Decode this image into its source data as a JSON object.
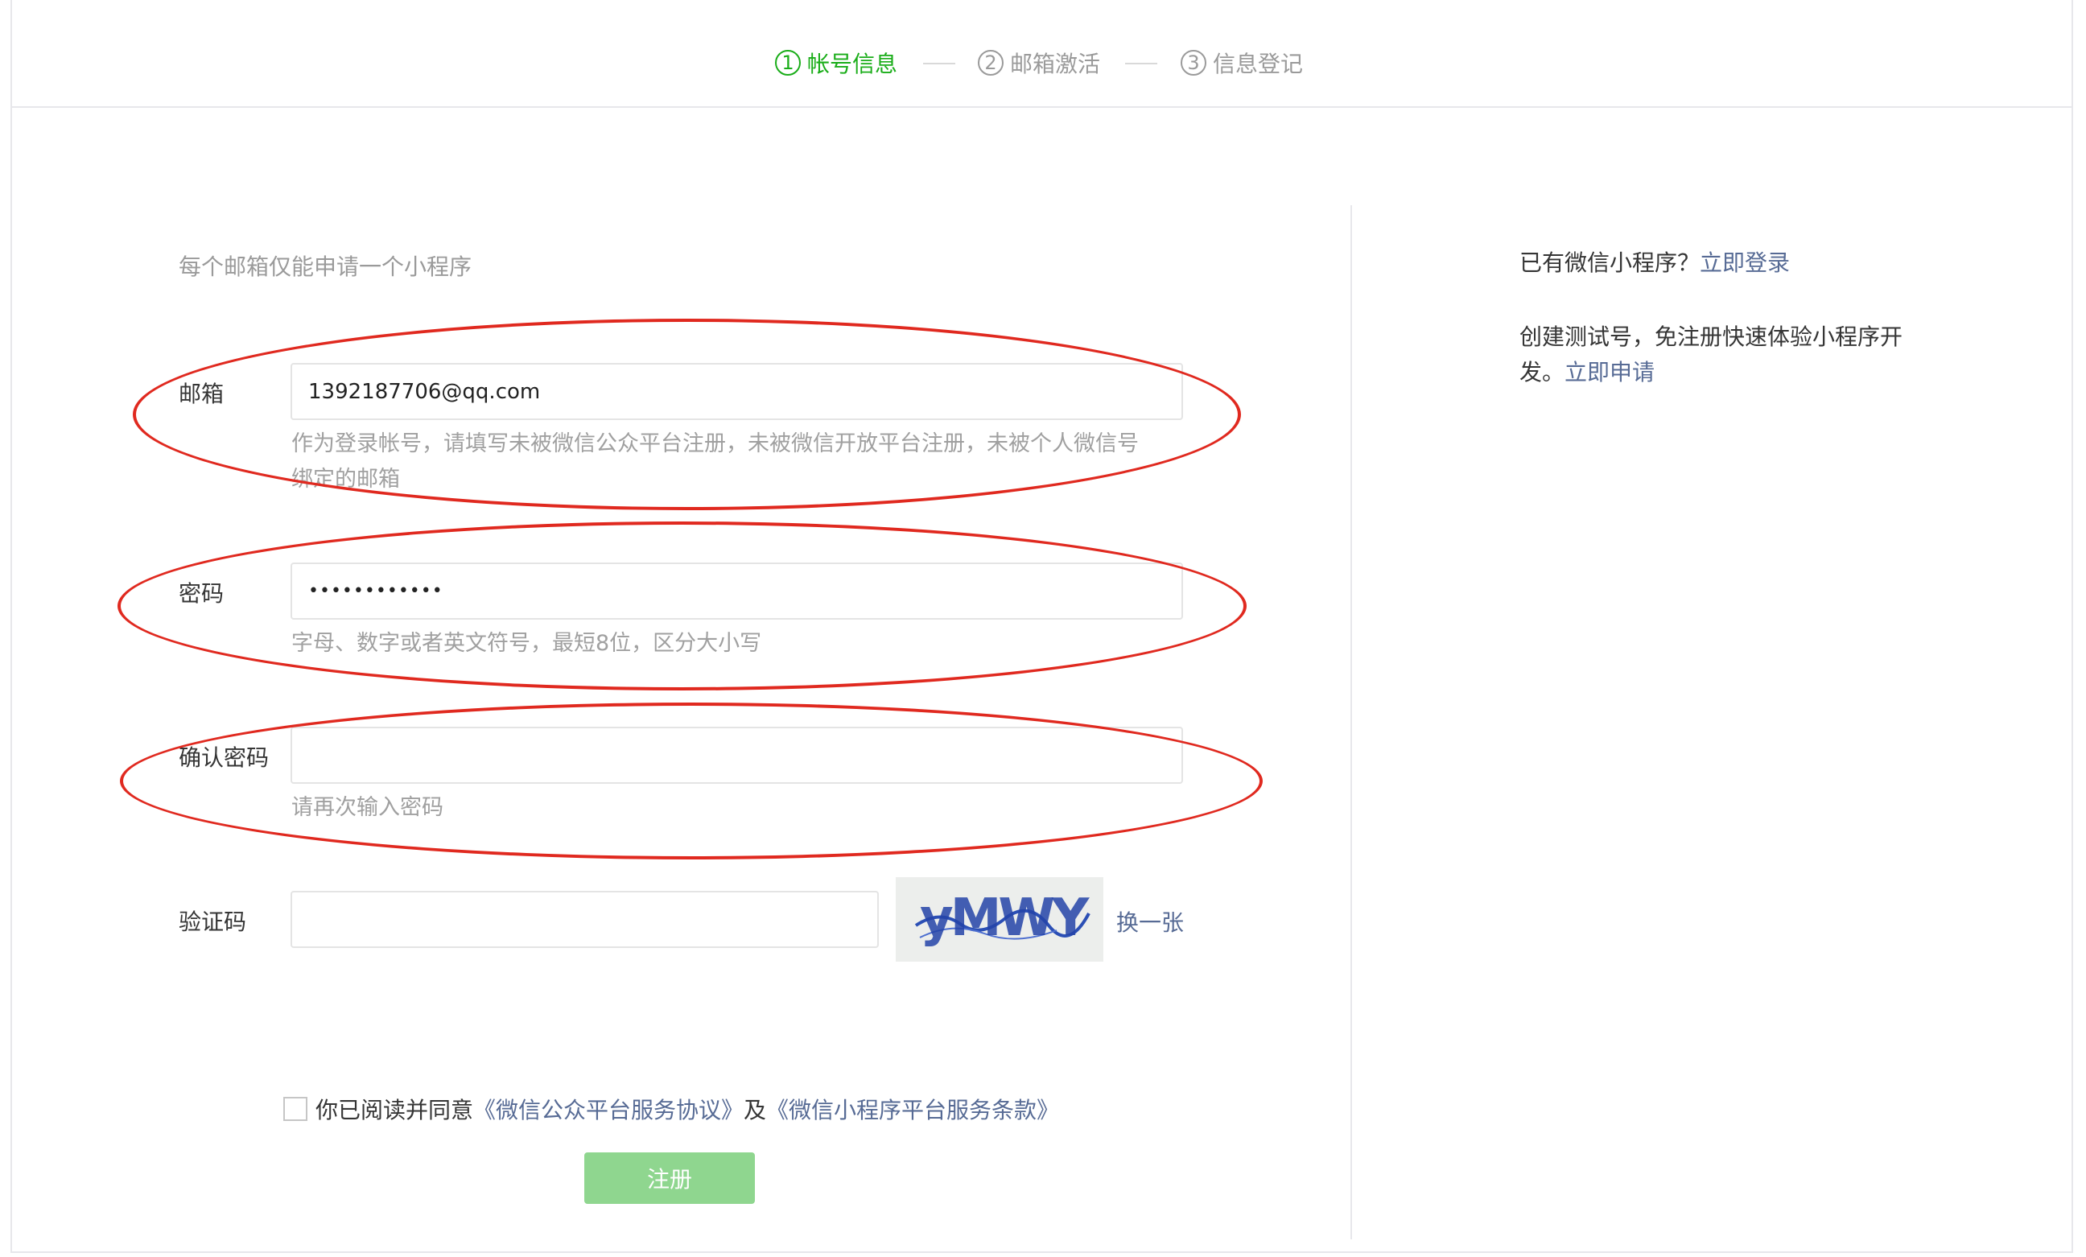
{
  "steps": [
    {
      "num": "1",
      "label": "帐号信息",
      "active": true
    },
    {
      "num": "2",
      "label": "邮箱激活",
      "active": false
    },
    {
      "num": "3",
      "label": "信息登记",
      "active": false
    }
  ],
  "form": {
    "tip": "每个邮箱仅能申请一个小程序",
    "email": {
      "label": "邮箱",
      "value": "1392187706@qq.com",
      "hint_line1": "作为登录帐号，请填写未被微信公众平台注册，未被微信开放平台注册，未被个人微信号",
      "hint_line2": "绑定的邮箱"
    },
    "password": {
      "label": "密码",
      "value": "••••••••••••",
      "hint": "字母、数字或者英文符号，最短8位，区分大小写"
    },
    "confirm": {
      "label": "确认密码",
      "value": "",
      "hint": "请再次输入密码"
    },
    "captcha": {
      "label": "验证码",
      "value": "",
      "image_text": "yMWY",
      "change": "换一张"
    },
    "agree": {
      "prefix": "你已阅读并同意",
      "link1": "《微信公众平台服务协议》",
      "and": "及",
      "link2": "《微信小程序平台服务条款》"
    },
    "submit": "注册"
  },
  "side": {
    "login_text": "已有微信小程序？",
    "login_link": "立即登录",
    "test_text_line1": "创建测试号，免注册快速体验小程序开",
    "test_text_line2": "发。",
    "test_link": "立即申请"
  },
  "colors": {
    "active_step": "#1aad19",
    "link": "#576b95",
    "annotation": "#e0291f",
    "button_disabled": "#8fd68f"
  }
}
